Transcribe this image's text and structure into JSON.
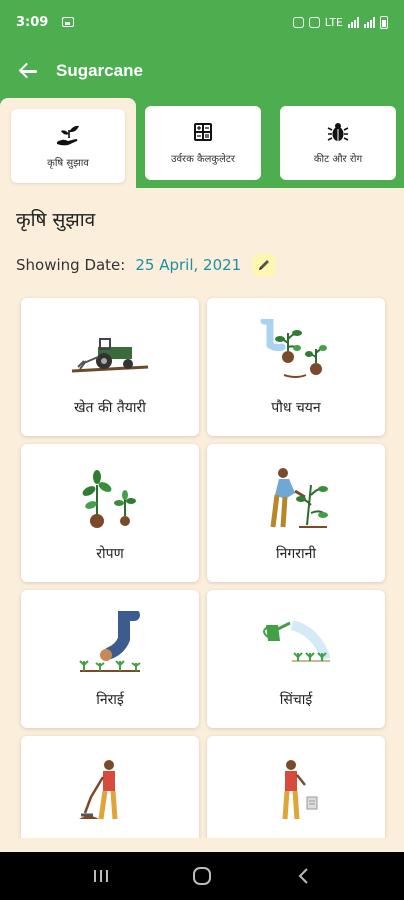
{
  "status_bar": {
    "time": "3:09",
    "indicators": "LTE"
  },
  "app_bar": {
    "title": "Sugarcane"
  },
  "tabs": [
    {
      "label": "कृषि सुझाव",
      "icon": "sprout-hand-icon",
      "active": true
    },
    {
      "label": "उर्वरक कैलकुलेटर",
      "icon": "calculator-icon",
      "active": false
    },
    {
      "label": "कीट और रोग",
      "icon": "bug-icon",
      "active": false
    }
  ],
  "section": {
    "title": "कृषि सुझाव"
  },
  "date": {
    "label": "Showing Date:",
    "value": "25 April, 2021"
  },
  "cards": [
    {
      "label": "खेत की तैयारी",
      "icon": "tractor-icon"
    },
    {
      "label": "पौध चयन",
      "icon": "plant-selection-icon"
    },
    {
      "label": "रोपण",
      "icon": "planting-icon"
    },
    {
      "label": "निगरानी",
      "icon": "monitoring-icon"
    },
    {
      "label": "निराई",
      "icon": "weeding-icon"
    },
    {
      "label": "सिंचाई",
      "icon": "watering-can-icon"
    },
    {
      "label": "",
      "icon": "farmer-digging-icon"
    },
    {
      "label": "",
      "icon": "farmer-fertilizer-icon"
    }
  ],
  "colors": {
    "primary_green": "#4cae4f",
    "background": "#fbefdc",
    "date_teal": "#1f8ea0"
  }
}
